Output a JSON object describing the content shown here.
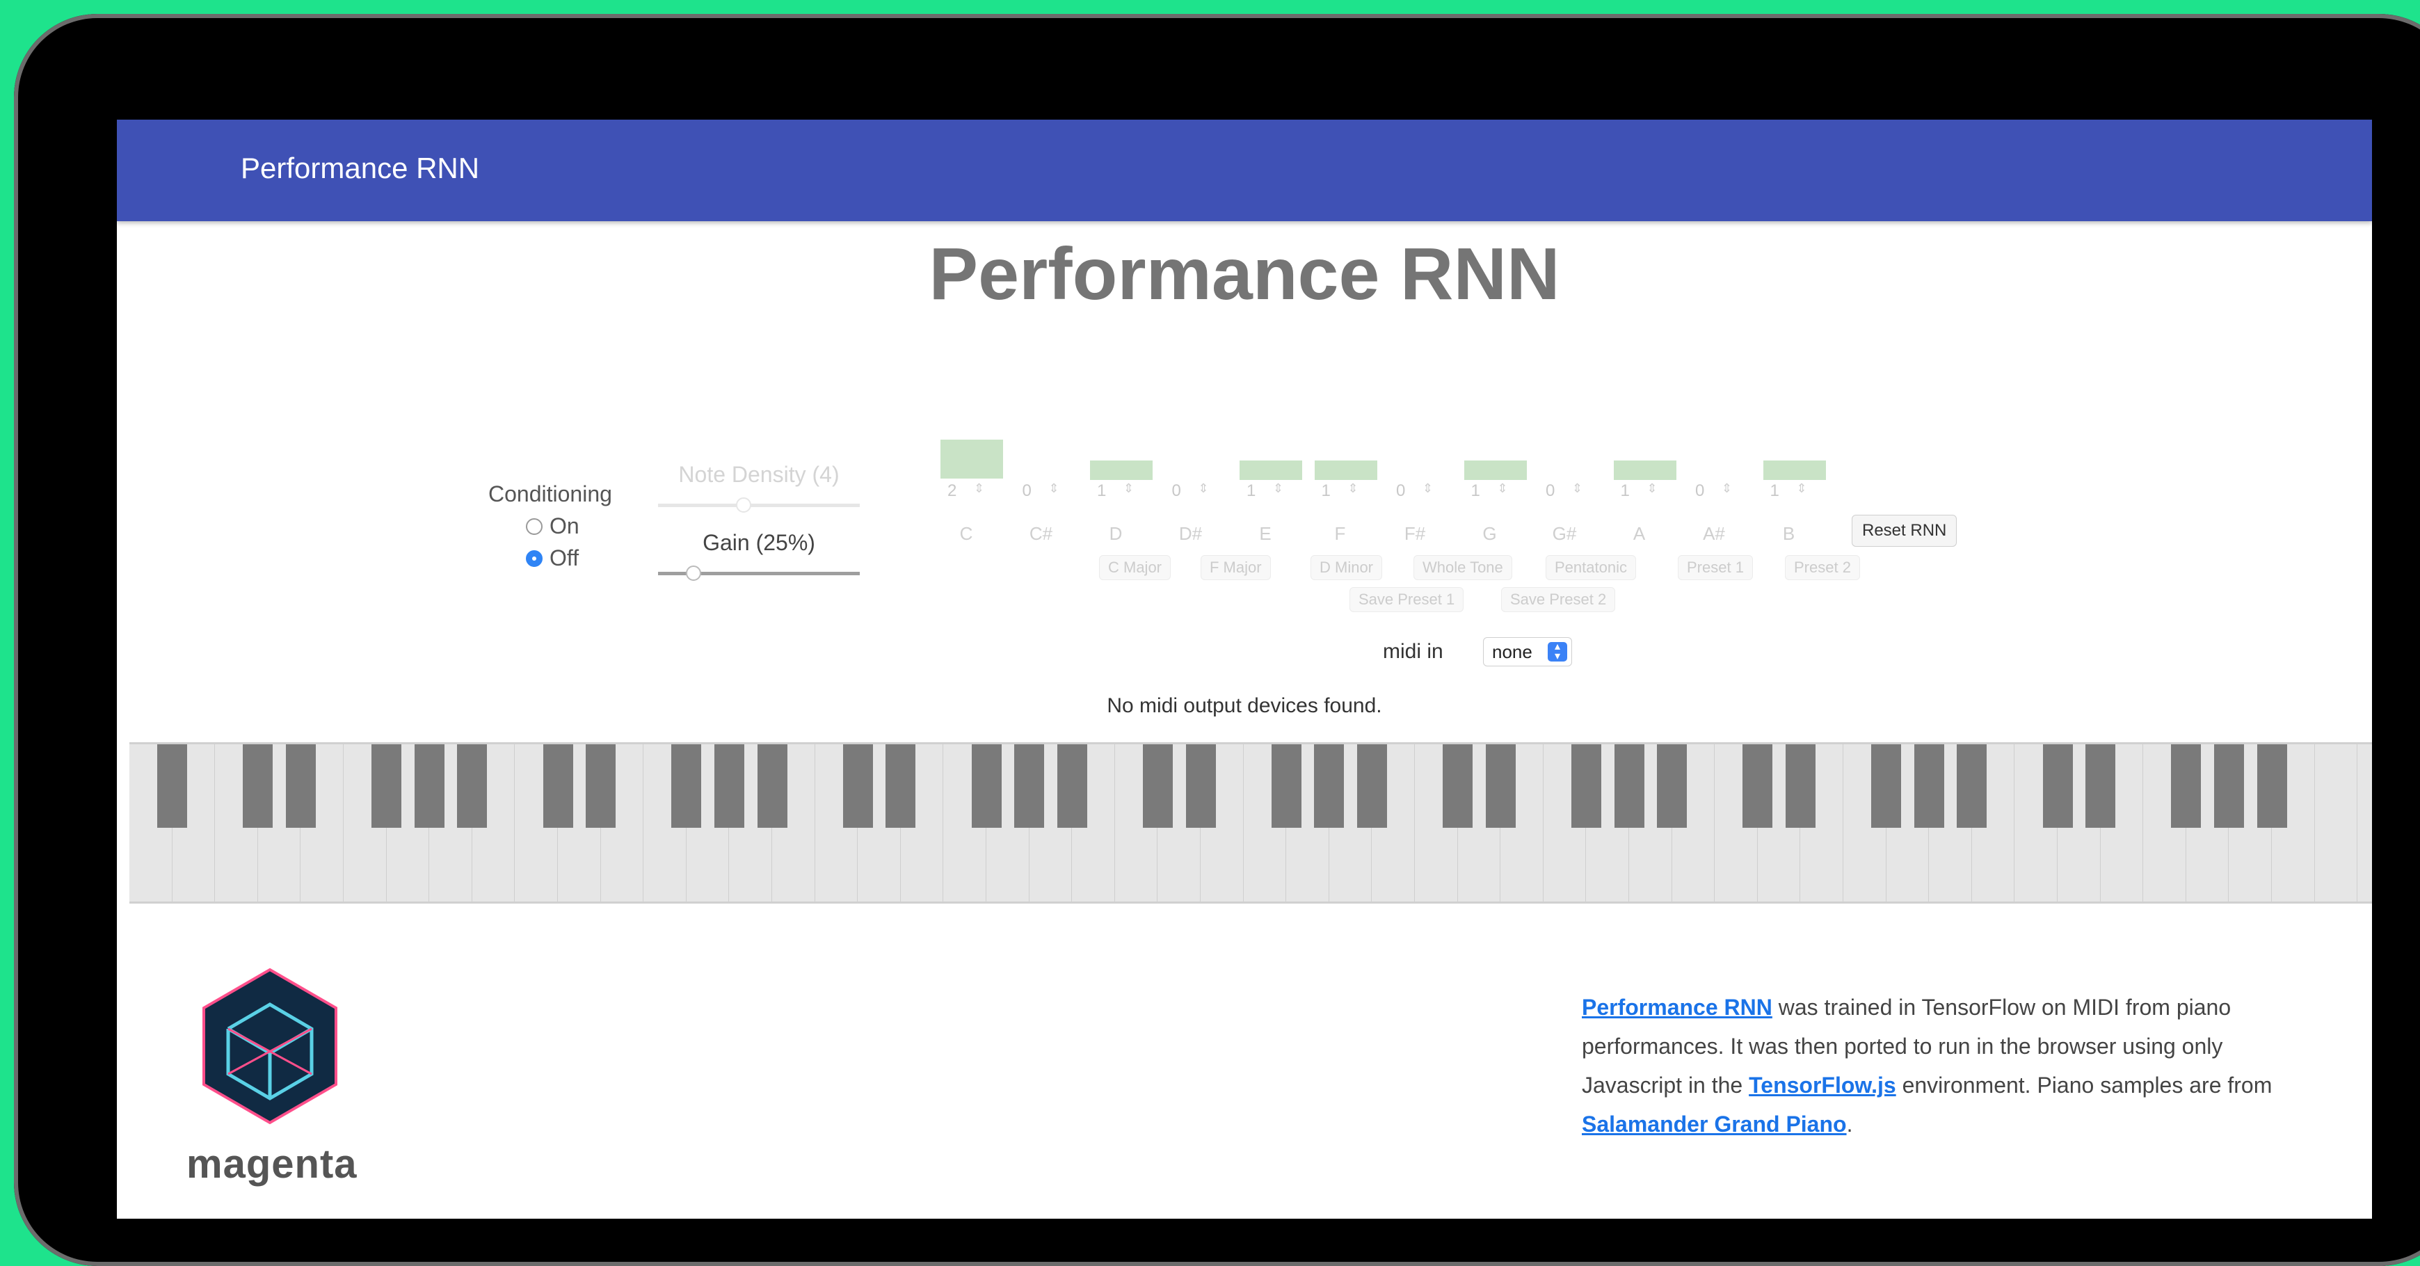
{
  "app_bar": {
    "title": "Performance RNN"
  },
  "page_title": "Performance RNN",
  "conditioning": {
    "label": "Conditioning",
    "options": [
      {
        "label": "On",
        "checked": false
      },
      {
        "label": "Off",
        "checked": true
      }
    ]
  },
  "note_density": {
    "label": "Note Density (4)"
  },
  "gain": {
    "label": "Gain (25%)",
    "level_percent": 25
  },
  "pitch_histogram": {
    "pitches": [
      {
        "name": "C",
        "value": "2",
        "level": 2
      },
      {
        "name": "C#",
        "value": "0",
        "level": 0
      },
      {
        "name": "D",
        "value": "1",
        "level": 1
      },
      {
        "name": "D#",
        "value": "0",
        "level": 0
      },
      {
        "name": "E",
        "value": "1",
        "level": 1
      },
      {
        "name": "F",
        "value": "1",
        "level": 1
      },
      {
        "name": "F#",
        "value": "0",
        "level": 0
      },
      {
        "name": "G",
        "value": "1",
        "level": 1
      },
      {
        "name": "G#",
        "value": "0",
        "level": 0
      },
      {
        "name": "A",
        "value": "1",
        "level": 1
      },
      {
        "name": "A#",
        "value": "0",
        "level": 0
      },
      {
        "name": "B",
        "value": "1",
        "level": 1
      }
    ],
    "bar_color": "#c9e3c6"
  },
  "presets": {
    "row1": [
      "C Major",
      "F Major",
      "D Minor",
      "Whole Tone",
      "Pentatonic",
      "Preset 1",
      "Preset 2"
    ],
    "row2": [
      "Save Preset 1",
      "Save Preset 2"
    ]
  },
  "reset_button": "Reset RNN",
  "midi": {
    "label": "midi in",
    "selected": "none",
    "status": "No midi output devices found."
  },
  "footer": {
    "logo_text": "magenta",
    "about": {
      "link1": "Performance RNN",
      "text1": " was trained in TensorFlow on MIDI from piano performances. It was then ported to run in the browser using only Javascript in the ",
      "link2": "TensorFlow.js",
      "text2": " environment. Piano samples are from ",
      "link3": "Salamander Grand Piano",
      "text3": "."
    }
  },
  "colors": {
    "app_bar": "#3f51b5",
    "background": "#1ee38c",
    "link": "#1a73e8"
  }
}
